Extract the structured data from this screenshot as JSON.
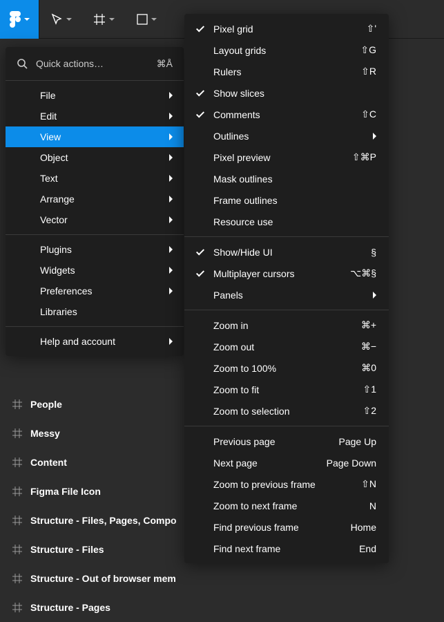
{
  "toolbar": {
    "logo_title": "Figma"
  },
  "quick_actions": {
    "label": "Quick actions…",
    "shortcut": "⌘Å"
  },
  "menu": [
    {
      "label": "File",
      "sub": true
    },
    {
      "label": "Edit",
      "sub": true
    },
    {
      "label": "View",
      "sub": true,
      "highlight": true
    },
    {
      "label": "Object",
      "sub": true
    },
    {
      "label": "Text",
      "sub": true
    },
    {
      "label": "Arrange",
      "sub": true
    },
    {
      "label": "Vector",
      "sub": true
    }
  ],
  "menu2": [
    {
      "label": "Plugins",
      "sub": true
    },
    {
      "label": "Widgets",
      "sub": true
    },
    {
      "label": "Preferences",
      "sub": true
    },
    {
      "label": "Libraries",
      "sub": false
    }
  ],
  "menu3": [
    {
      "label": "Help and account",
      "sub": true
    }
  ],
  "view_sub": {
    "g1": [
      {
        "label": "Pixel grid",
        "check": true,
        "shortcut": "⇧'"
      },
      {
        "label": "Layout grids",
        "check": false,
        "shortcut": "⇧G"
      },
      {
        "label": "Rulers",
        "check": false,
        "shortcut": "⇧R"
      },
      {
        "label": "Show slices",
        "check": true,
        "shortcut": ""
      },
      {
        "label": "Comments",
        "check": true,
        "shortcut": "⇧C"
      },
      {
        "label": "Outlines",
        "check": false,
        "arrow": true
      },
      {
        "label": "Pixel preview",
        "check": false,
        "shortcut": "⇧⌘P"
      },
      {
        "label": "Mask outlines",
        "check": false,
        "shortcut": ""
      },
      {
        "label": "Frame outlines",
        "check": false,
        "shortcut": ""
      },
      {
        "label": "Resource use",
        "check": false,
        "shortcut": ""
      }
    ],
    "g2": [
      {
        "label": "Show/Hide UI",
        "check": true,
        "shortcut": "§"
      },
      {
        "label": "Multiplayer cursors",
        "check": true,
        "shortcut": "⌥⌘§"
      },
      {
        "label": "Panels",
        "check": false,
        "arrow": true
      }
    ],
    "g3": [
      {
        "label": "Zoom in",
        "shortcut": "⌘+"
      },
      {
        "label": "Zoom out",
        "shortcut": "⌘−"
      },
      {
        "label": "Zoom to 100%",
        "shortcut": "⌘0"
      },
      {
        "label": "Zoom to fit",
        "shortcut": "⇧1"
      },
      {
        "label": "Zoom to selection",
        "shortcut": "⇧2"
      }
    ],
    "g4": [
      {
        "label": "Previous page",
        "shortcut": "Page Up"
      },
      {
        "label": "Next page",
        "shortcut": "Page Down"
      },
      {
        "label": "Zoom to previous frame",
        "shortcut": "⇧N"
      },
      {
        "label": "Zoom to next frame",
        "shortcut": "N"
      },
      {
        "label": "Find previous frame",
        "shortcut": "Home"
      },
      {
        "label": "Find next frame",
        "shortcut": "End"
      }
    ]
  },
  "layers": [
    "People",
    "Messy",
    "Content",
    "Figma File Icon",
    "Structure - Files, Pages, Compo",
    "Structure - Files",
    "Structure - Out of browser mem",
    "Structure - Pages"
  ]
}
